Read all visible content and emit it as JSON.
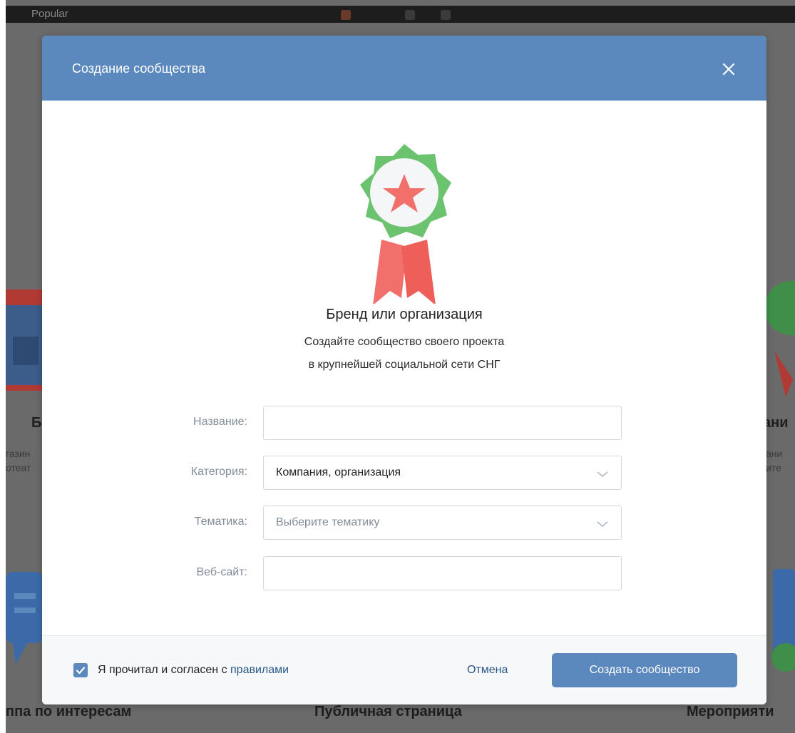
{
  "topbar": {
    "text": "Popular"
  },
  "background": {
    "left_heading": "Б",
    "left_line1": "газин",
    "left_line2": "отеат",
    "right_heading": "ани",
    "right_line1": "ани",
    "right_line2": "ите",
    "bottom_left": "ппа по интересам",
    "bottom_center": "Публичная страница",
    "bottom_right": "Мероприяти"
  },
  "modal": {
    "title": "Создание сообщества",
    "heading": "Бренд или организация",
    "description_line1": "Создайте сообщество своего проекта",
    "description_line2": "в крупнейшей социальной сети СНГ"
  },
  "form": {
    "name": {
      "label": "Название:",
      "value": "",
      "placeholder": ""
    },
    "category": {
      "label": "Категория:",
      "value": "Компания, организация"
    },
    "topic": {
      "label": "Тематика:",
      "placeholder": "Выберите тематику"
    },
    "website": {
      "label": "Веб-сайт:",
      "value": "",
      "placeholder": ""
    }
  },
  "footer": {
    "agree_checked": true,
    "agree_text": "Я прочитал и согласен с ",
    "rules_link": "правилами",
    "cancel": "Отмена",
    "create": "Создать сообщество"
  },
  "icons": {
    "close": "close-icon",
    "check": "checkmark-icon",
    "chevron": "chevron-down-icon",
    "badge": "award-badge-icon"
  },
  "colors": {
    "header": "#5b88bd",
    "primary_button": "#5b88bd",
    "link": "#2a5885",
    "label": "#818c99",
    "badge_green": "#6cc36f",
    "badge_red": "#f2706b"
  }
}
